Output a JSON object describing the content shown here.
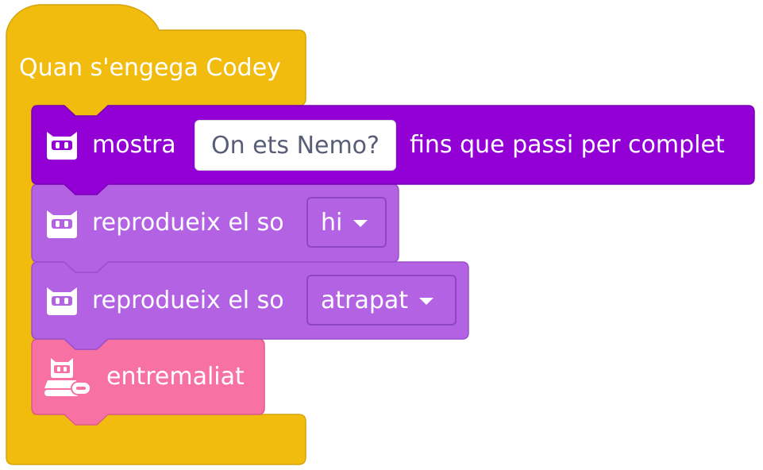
{
  "hat_block": {
    "label": "Quan s'engega Codey",
    "color": "#f2bc0e"
  },
  "show_block": {
    "label_prefix": "mostra",
    "text_value": "On ets Nemo?",
    "label_suffix": "fins que passi per complet",
    "icon": "codey-robot-icon",
    "color": "#9200d6"
  },
  "sound_block_1": {
    "label": "reprodueix el so",
    "dropdown_value": "hi",
    "icon": "codey-robot-icon",
    "color": "#b362e4"
  },
  "sound_block_2": {
    "label": "reprodueix el so",
    "dropdown_value": "atrapat",
    "icon": "codey-robot-icon",
    "color": "#b362e4"
  },
  "emotion_block": {
    "label": "entremaliat",
    "icon": "codey-rocky-icon",
    "color": "#f771a2"
  }
}
